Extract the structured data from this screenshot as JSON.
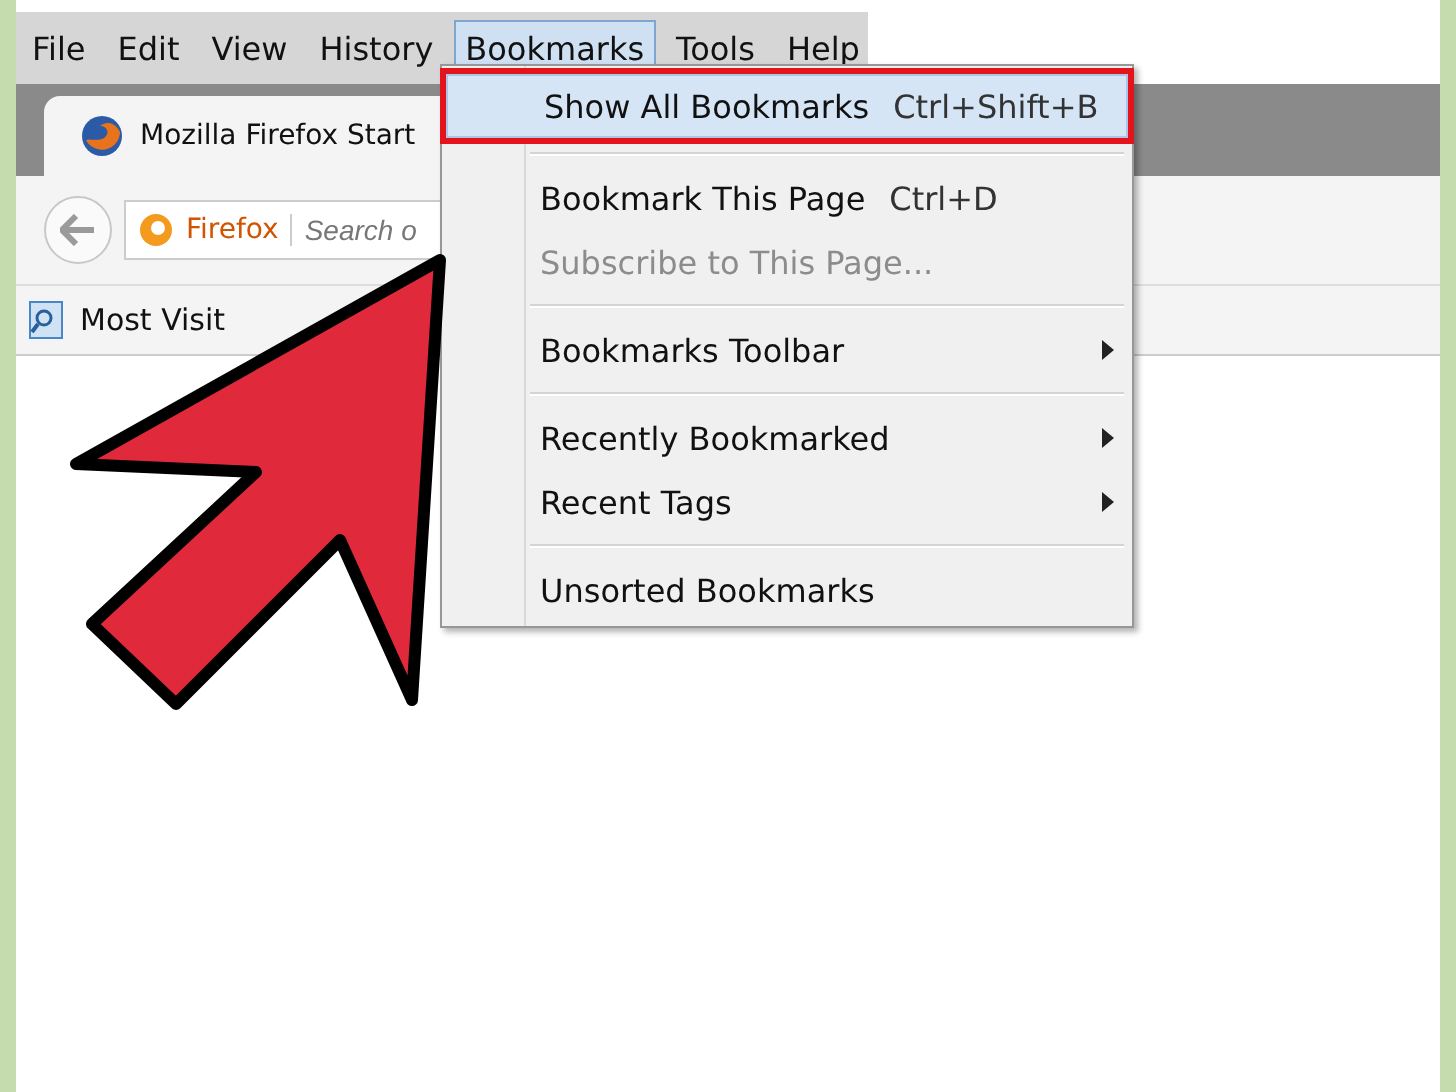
{
  "menubar": [
    {
      "label": "File",
      "selected": false
    },
    {
      "label": "Edit",
      "selected": false
    },
    {
      "label": "View",
      "selected": false
    },
    {
      "label": "History",
      "selected": false
    },
    {
      "label": "Bookmarks",
      "selected": true
    },
    {
      "label": "Tools",
      "selected": false
    },
    {
      "label": "Help",
      "selected": false
    }
  ],
  "tab": {
    "title": "Mozilla Firefox Start"
  },
  "address_bar": {
    "identity": "Firefox",
    "placeholder": "Search o"
  },
  "bookmarks_toolbar": {
    "label": "Most Visit"
  },
  "menu": {
    "groups": [
      [
        {
          "label": "Show All Bookmarks",
          "shortcut": "Ctrl+Shift+B",
          "selected": true,
          "highlighted": true,
          "disabled": false,
          "submenu": false
        }
      ],
      [
        {
          "label": "Bookmark This Page",
          "shortcut": "Ctrl+D",
          "selected": false,
          "highlighted": false,
          "disabled": false,
          "submenu": false
        },
        {
          "label": "Subscribe to This Page...",
          "selected": false,
          "highlighted": false,
          "disabled": true,
          "submenu": false
        }
      ],
      [
        {
          "label": "Bookmarks Toolbar",
          "selected": false,
          "highlighted": false,
          "disabled": false,
          "submenu": true
        }
      ],
      [
        {
          "label": "Recently Bookmarked",
          "selected": false,
          "highlighted": false,
          "disabled": false,
          "submenu": true
        },
        {
          "label": "Recent Tags",
          "selected": false,
          "highlighted": false,
          "disabled": false,
          "submenu": true
        }
      ],
      [
        {
          "label": "Unsorted Bookmarks",
          "selected": false,
          "highlighted": false,
          "disabled": false,
          "submenu": false
        }
      ]
    ]
  }
}
